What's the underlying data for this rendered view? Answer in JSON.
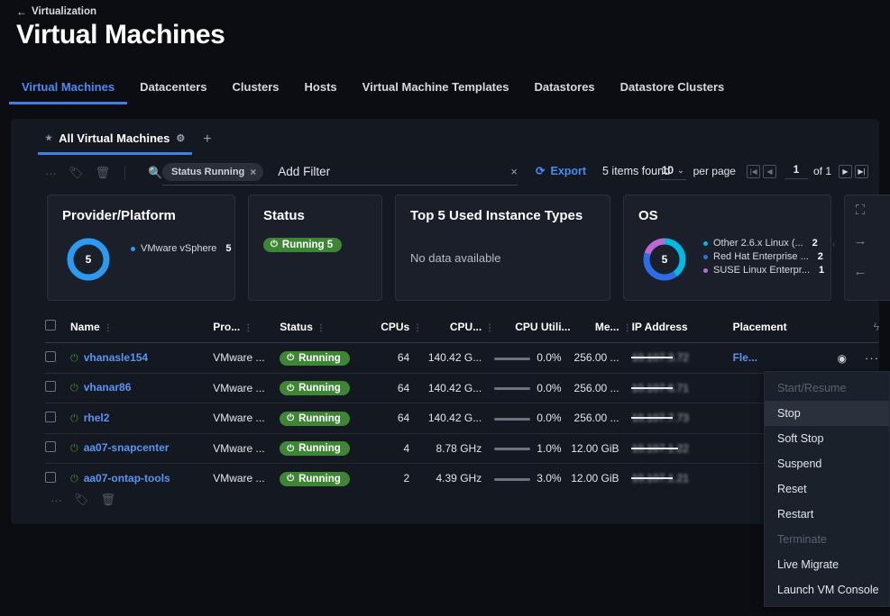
{
  "header": {
    "breadcrumb_arrow": "←",
    "breadcrumb": "Virtualization",
    "title": "Virtual Machines"
  },
  "top_tabs": [
    {
      "label": "Virtual Machines",
      "active": true
    },
    {
      "label": "Datacenters",
      "active": false
    },
    {
      "label": "Clusters",
      "active": false
    },
    {
      "label": "Hosts",
      "active": false
    },
    {
      "label": "Virtual Machine Templates",
      "active": false
    },
    {
      "label": "Datastores",
      "active": false
    },
    {
      "label": "Datastore Clusters",
      "active": false
    }
  ],
  "saved_tab": {
    "star_icon": "star-icon",
    "label": "All Virtual Machines",
    "gear_icon": "gear-icon",
    "add_icon": "+"
  },
  "toolbar": {
    "kebab_icon": "···",
    "tag_icon": "tag-icon",
    "trash_icon": "trash-icon",
    "search_icon": "search-icon",
    "chip_label": "Status Running",
    "chip_close": "×",
    "add_filter": "Add Filter",
    "filter_clear": "×",
    "export_icon": "export-icon",
    "export_label": "Export",
    "items_found": "5 items found",
    "per_page_value": "10",
    "per_page_caret": "⌄",
    "per_page_label": "per page",
    "first_page_icon": "⏮",
    "prev_page_icon": "◀",
    "page_number": "1",
    "of_label": "of 1",
    "next_page_icon": "▶",
    "last_page_icon": "⏭"
  },
  "cards": {
    "provider": {
      "title": "Provider/Platform",
      "total": "5",
      "donut_color": "#2b9af3",
      "legend": [
        {
          "label": "VMware vSphere",
          "value": "5",
          "color": "#2b9af3"
        }
      ]
    },
    "status": {
      "title": "Status",
      "badge_icon": "power-icon",
      "badge_label": "Running 5",
      "badge_color": "#3e8635"
    },
    "instance": {
      "title": "Top 5 Used Instance Types",
      "empty_text": "No data available"
    },
    "os": {
      "title": "OS",
      "total": "5",
      "legend": [
        {
          "label": "Other 2.6.x Linux (...",
          "value": "2",
          "color": "#00b9e4"
        },
        {
          "label": "Red Hat Enterprise ...",
          "value": "2",
          "color": "#2b6ee8"
        },
        {
          "label": "SUSE Linux Enterpr...",
          "value": "1",
          "color": "#b86bd6"
        }
      ]
    },
    "rail": {
      "chevron_icon": "‹",
      "expand_icon": "expand-icon",
      "next_icon": "→",
      "back_icon": "←"
    }
  },
  "table": {
    "select_all_checkbox": "select-all",
    "columns": [
      {
        "label": "Name",
        "grip": true,
        "align": "left"
      },
      {
        "label": "Pro...",
        "grip": true,
        "align": "left"
      },
      {
        "label": "Status",
        "grip": true,
        "align": "left"
      },
      {
        "label": "CPUs",
        "grip": true,
        "align": "right"
      },
      {
        "label": "CPU...",
        "grip": true,
        "align": "right"
      },
      {
        "label": "CPU Utili...",
        "grip": false,
        "align": "right"
      },
      {
        "label": "Me...",
        "grip": true,
        "align": "right"
      },
      {
        "label": "IP Address",
        "grip": false,
        "align": "left"
      },
      {
        "label": "Placement",
        "grip": false,
        "align": "left"
      }
    ],
    "header_bolt_icon": "bolt-icon",
    "rows": [
      {
        "name": "vhanasle154",
        "provider": "VMware ...",
        "status": "Running",
        "cpus": "64",
        "cpu_speed": "140.42 G...",
        "cpu_util": "0.0%",
        "memory": "256.00 ...",
        "ip": "10.107.3.72",
        "ip_visible_tail": "3.72",
        "placement": "Fle...",
        "show_placement_icons": true
      },
      {
        "name": "vhanar86",
        "provider": "VMware ...",
        "status": "Running",
        "cpus": "64",
        "cpu_speed": "140.42 G...",
        "cpu_util": "0.0%",
        "memory": "256.00 ...",
        "ip": "10.107.6.71",
        "ip_visible_tail": "6.71",
        "placement": "",
        "show_placement_icons": false
      },
      {
        "name": "rhel2",
        "provider": "VMware ...",
        "status": "Running",
        "cpus": "64",
        "cpu_speed": "140.42 G...",
        "cpu_util": "0.0%",
        "memory": "256.00 ...",
        "ip": "10.107.7.73",
        "ip_visible_tail": "7.73",
        "placement": "",
        "show_placement_icons": false
      },
      {
        "name": "aa07-snapcenter",
        "provider": "VMware ...",
        "status": "Running",
        "cpus": "4",
        "cpu_speed": "8.78 GHz",
        "cpu_util": "1.0%",
        "memory": "12.00 GiB",
        "ip": "10.107.1.22",
        "ip_visible_tail": ".22",
        "placement": "",
        "show_placement_icons": false
      },
      {
        "name": "aa07-ontap-tools",
        "provider": "VMware ...",
        "status": "Running",
        "cpus": "2",
        "cpu_speed": "4.39 GHz",
        "cpu_util": "3.0%",
        "memory": "12.00 GiB",
        "ip": "10.107.1.21",
        "ip_visible_tail": "1.21",
        "placement": "",
        "show_placement_icons": false
      }
    ]
  },
  "bottom_toolbar": {
    "kebab_icon": "···",
    "tag_icon": "tag-icon",
    "trash_icon": "trash-icon"
  },
  "context_menu": [
    {
      "label": "Start/Resume",
      "disabled": true,
      "highlighted": false
    },
    {
      "label": "Stop",
      "disabled": false,
      "highlighted": true
    },
    {
      "label": "Soft Stop",
      "disabled": false,
      "highlighted": false
    },
    {
      "label": "Suspend",
      "disabled": false,
      "highlighted": false
    },
    {
      "label": "Reset",
      "disabled": false,
      "highlighted": false
    },
    {
      "label": "Restart",
      "disabled": false,
      "highlighted": false
    },
    {
      "label": "Terminate",
      "disabled": true,
      "highlighted": false
    },
    {
      "label": "Live Migrate",
      "disabled": false,
      "highlighted": false
    },
    {
      "label": "Launch VM Console",
      "disabled": false,
      "highlighted": false
    }
  ]
}
